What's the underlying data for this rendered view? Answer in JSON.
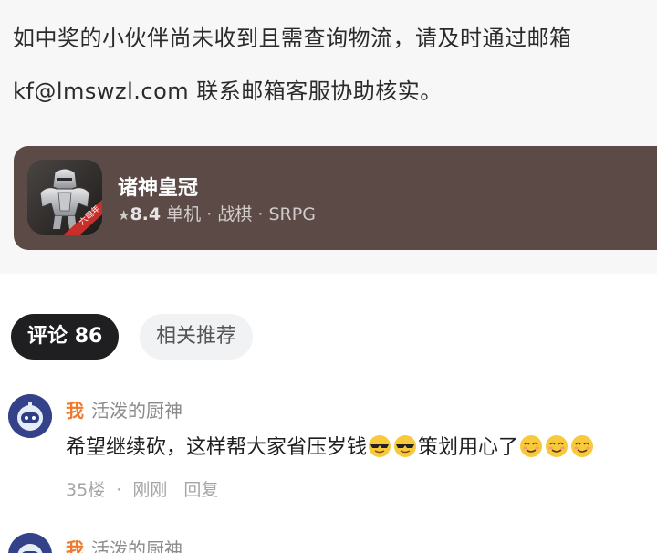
{
  "article": {
    "line1": "如中奖的小伙伴尚未收到且需查询物流，请及时通过邮箱",
    "line2": "kf@lmswzl.com 联系邮箱客服协助核实。"
  },
  "game": {
    "title": "诸神皇冠",
    "star_icon": "star-icon",
    "rating": "8.4",
    "tags": [
      "单机",
      "战棋",
      "SRPG"
    ],
    "separator": "·",
    "badge": "六周年"
  },
  "tabs": {
    "comments_label": "评论",
    "comments_count": "86",
    "related_label": "相关推荐"
  },
  "comments": [
    {
      "me_tag": "我",
      "author": "活泼的厨神",
      "text_part1": "希望继续砍，这样帮大家省压岁钱",
      "text_part2": "策划用心了",
      "floor": "35楼",
      "time": "刚刚",
      "reply": "回复"
    },
    {
      "me_tag": "我",
      "author": "活泼的厨神"
    }
  ],
  "colors": {
    "card_bg": "#5b4a46",
    "tab_active_bg": "#1f1f21",
    "me_tag": "#f07a2c"
  }
}
